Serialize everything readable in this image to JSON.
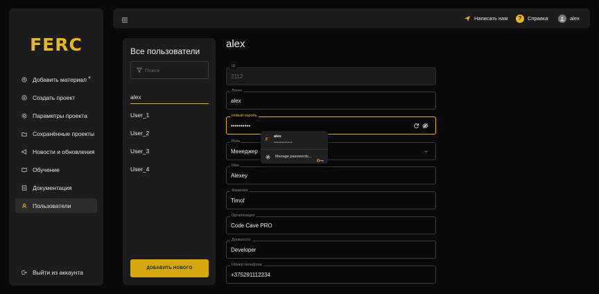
{
  "sidebar": {
    "logo": "FERC",
    "items": [
      {
        "label": "Добавить материал",
        "icon": "plus-circle-icon",
        "has_caret": true
      },
      {
        "label": "Создать проект",
        "icon": "plus-circle-icon"
      },
      {
        "label": "Параметры проекта",
        "icon": "gear-icon"
      },
      {
        "label": "Сохранённые проекты",
        "icon": "folder-icon"
      },
      {
        "label": "Новости и обновления",
        "icon": "megaphone-icon"
      },
      {
        "label": "Обучение",
        "icon": "book-icon"
      },
      {
        "label": "Документация",
        "icon": "document-icon"
      },
      {
        "label": "Пользователи",
        "icon": "user-icon",
        "active": true
      }
    ],
    "logout": "Выйти из аккаунта"
  },
  "header": {
    "write_us": "Написать нам",
    "help": "Справка",
    "help_glyph": "?",
    "username": "alex",
    "accent": "#e8b722"
  },
  "users_panel": {
    "title": "Все пользователи",
    "search_placeholder": "Поиск",
    "users": [
      "alex",
      "User_1",
      "User_2",
      "User_3",
      "User_4"
    ],
    "active_user": "alex",
    "add_button": "ДОБАВИТЬ НОВОГО"
  },
  "form": {
    "title": "alex",
    "fields": {
      "id": {
        "label": "ID",
        "value": "2112"
      },
      "login": {
        "label": "Логин",
        "value": "alex"
      },
      "password": {
        "label": "Новый пароль",
        "value": "••••••••••"
      },
      "role": {
        "label": "Роль",
        "value": "Менеджер"
      },
      "first_name": {
        "label": "Имя",
        "value": "Alexey"
      },
      "last_name": {
        "label": "Фамилия",
        "value": "Timof"
      },
      "organization": {
        "label": "Организация",
        "value": "Code Cave PRO"
      },
      "position": {
        "label": "Должность",
        "value": "Developer"
      },
      "phone": {
        "label": "Номер телефона",
        "value": "+375291112234"
      }
    }
  },
  "autofill": {
    "logo_letter": "F",
    "username": "alex",
    "password_mask": "••••••••••••",
    "manage": "Manage passwords..."
  }
}
